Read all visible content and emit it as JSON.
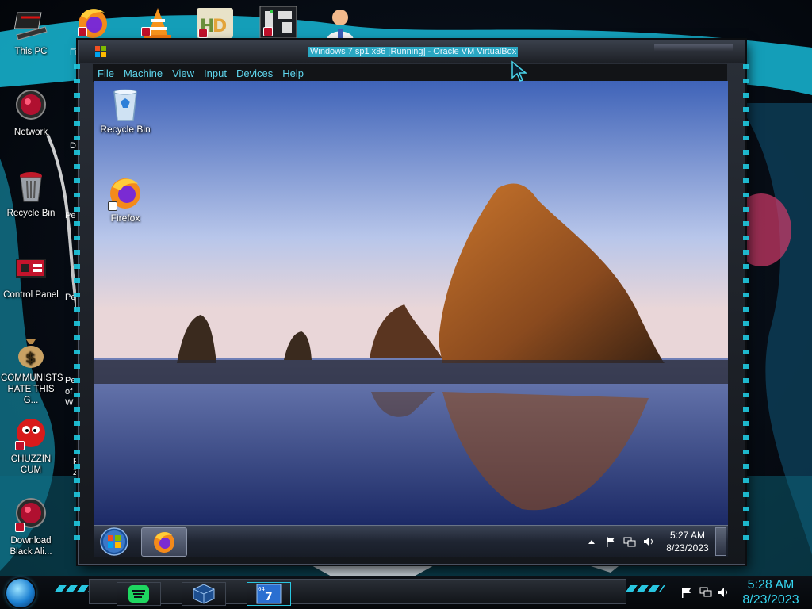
{
  "host": {
    "desktop_icons": [
      {
        "label": "This PC"
      },
      {
        "label": "Network"
      },
      {
        "label": "Recycle Bin"
      },
      {
        "label": "Control Panel"
      },
      {
        "label": "COMMUNISTS HATE THIS G..."
      },
      {
        "label": "CHUZZIN CUM"
      },
      {
        "label": "Download Black Ali..."
      }
    ],
    "partial_labels": [
      "Fi",
      "DU",
      "Peg",
      "Peg",
      "Peg of W",
      "P Z"
    ],
    "clock": {
      "time": "5:28 AM",
      "date": "8/23/2023"
    },
    "accent_color": "#22c8e4"
  },
  "vbox": {
    "title": "Windows 7 sp1 x86 [Running] - Oracle VM VirtualBox",
    "menu": [
      "File",
      "Machine",
      "View",
      "Input",
      "Devices",
      "Help"
    ]
  },
  "guest": {
    "desktop_icons": [
      {
        "label": "Recycle Bin"
      },
      {
        "label": "Firefox"
      }
    ],
    "clock": {
      "time": "5:27 AM",
      "date": "8/23/2023"
    }
  }
}
